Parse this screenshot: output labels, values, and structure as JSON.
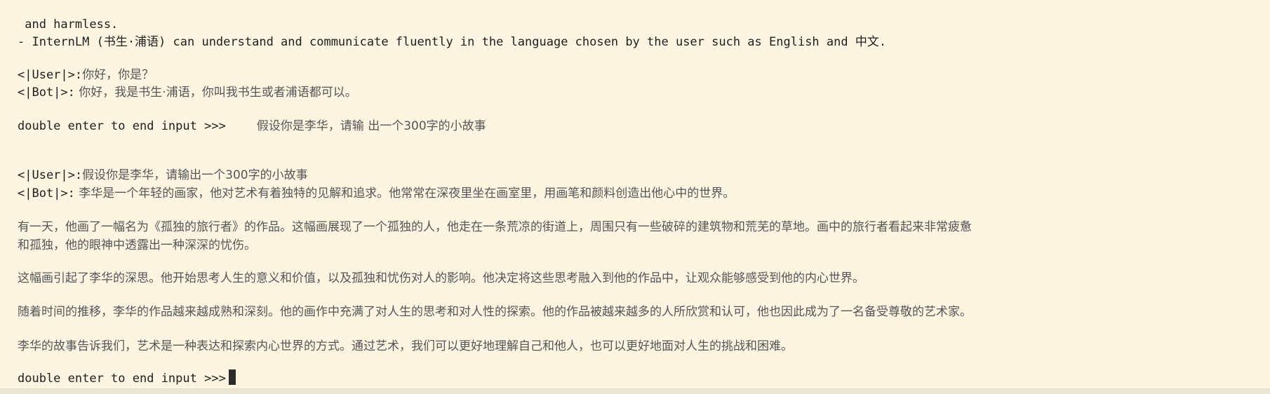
{
  "terminal": {
    "system_tail": " and harmless.",
    "system_line": "- InternLM (书生·浦语) can understand and communicate fluently in the language chosen by the user such as English and 中文.",
    "history": [
      {
        "role": "<|User|>:",
        "text": "你好，你是？"
      },
      {
        "role": "<|Bot|>:",
        "text": " 你好，我是书生·浦语，你叫我书生或者浦语都可以。"
      }
    ],
    "prompt": "double enter to end input >>>",
    "typed_input": "假设你是李华，请输 出一个300字的小故事",
    "user_turn": {
      "role": "<|User|>:",
      "text": "假设你是李华，请输出一个300字的小故事"
    },
    "bot_turn": {
      "role": "<|Bot|>:",
      "text": " 李华是一个年轻的画家，他对艺术有着独特的见解和追求。他常常在深夜里坐在画室里，用画笔和颜料创造出他心中的世界。"
    },
    "paragraphs": [
      "有一天，他画了一幅名为《孤独的旅行者》的作品。这幅画展现了一个孤独的人，他走在一条荒凉的街道上，周围只有一些破碎的建筑物和荒芜的草地。画中的旅行者看起来非常疲惫",
      "和孤独，他的眼神中透露出一种深深的忧伤。",
      "这幅画引起了李华的深思。他开始思考人生的意义和价值，以及孤独和忧伤对人的影响。他决定将这些思考融入到他的作品中，让观众能够感受到他的内心世界。",
      "随着时间的推移，李华的作品越来越成熟和深刻。他的画作中充满了对人生的思考和对人性的探索。他的作品被越来越多的人所欣赏和认可，他也因此成为了一名备受尊敬的艺术家。",
      "李华的故事告诉我们，艺术是一种表达和探索内心世界的方式。通过艺术，我们可以更好地理解自己和他人，也可以更好地面对人生的挑战和困难。"
    ],
    "final_prompt": "double enter to end input >>>"
  }
}
